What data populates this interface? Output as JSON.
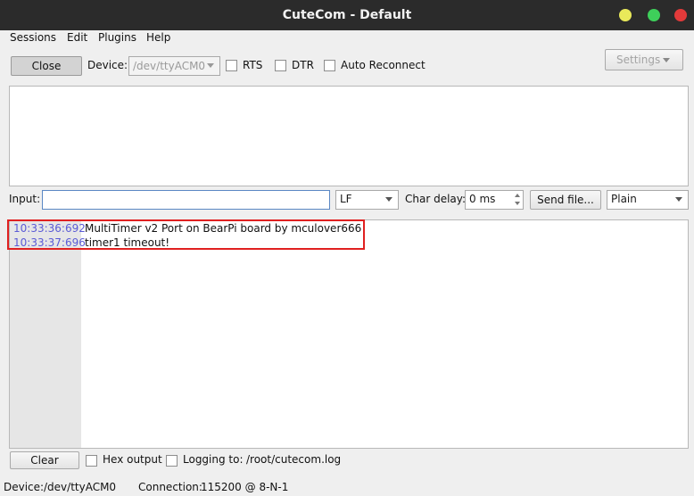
{
  "window": {
    "title": "CuteCom - Default",
    "controls": {
      "minimize_color": "#e9e95a",
      "maximize_color": "#3ecf5a",
      "close_color": "#e23a3a"
    }
  },
  "menu": [
    "Sessions",
    "Edit",
    "Plugins",
    "Help"
  ],
  "toolbar": {
    "close_label": "Close",
    "device_label": "Device:",
    "device_value": "/dev/ttyACM0",
    "rts_label": "RTS",
    "dtr_label": "DTR",
    "auto_reconnect_label": "Auto Reconnect",
    "settings_label": "Settings"
  },
  "input_row": {
    "input_label": "Input:",
    "input_value": "",
    "line_end": "LF",
    "char_delay_label": "Char delay:",
    "char_delay_value": "0 ms",
    "send_file_label": "Send file...",
    "format": "Plain"
  },
  "log": [
    {
      "time": "10:33:36:692",
      "text": "MultiTimer v2 Port on BearPi board by mculover666!"
    },
    {
      "time": "10:33:37:696",
      "text": "timer1 timeout!"
    }
  ],
  "bottom_row": {
    "clear_label": "Clear",
    "hex_output_label": "Hex output",
    "logging_label": "Logging to:",
    "log_path": "/root/cutecom.log"
  },
  "status": {
    "device_label": "Device:",
    "device_value": "/dev/ttyACM0",
    "connection_label": "Connection:",
    "connection_value": "115200 @ 8-N-1"
  },
  "colors": {
    "timestamp": "#5b5bd6",
    "highlight_border": "#e02020",
    "titlebar": "#2b2b2b"
  }
}
